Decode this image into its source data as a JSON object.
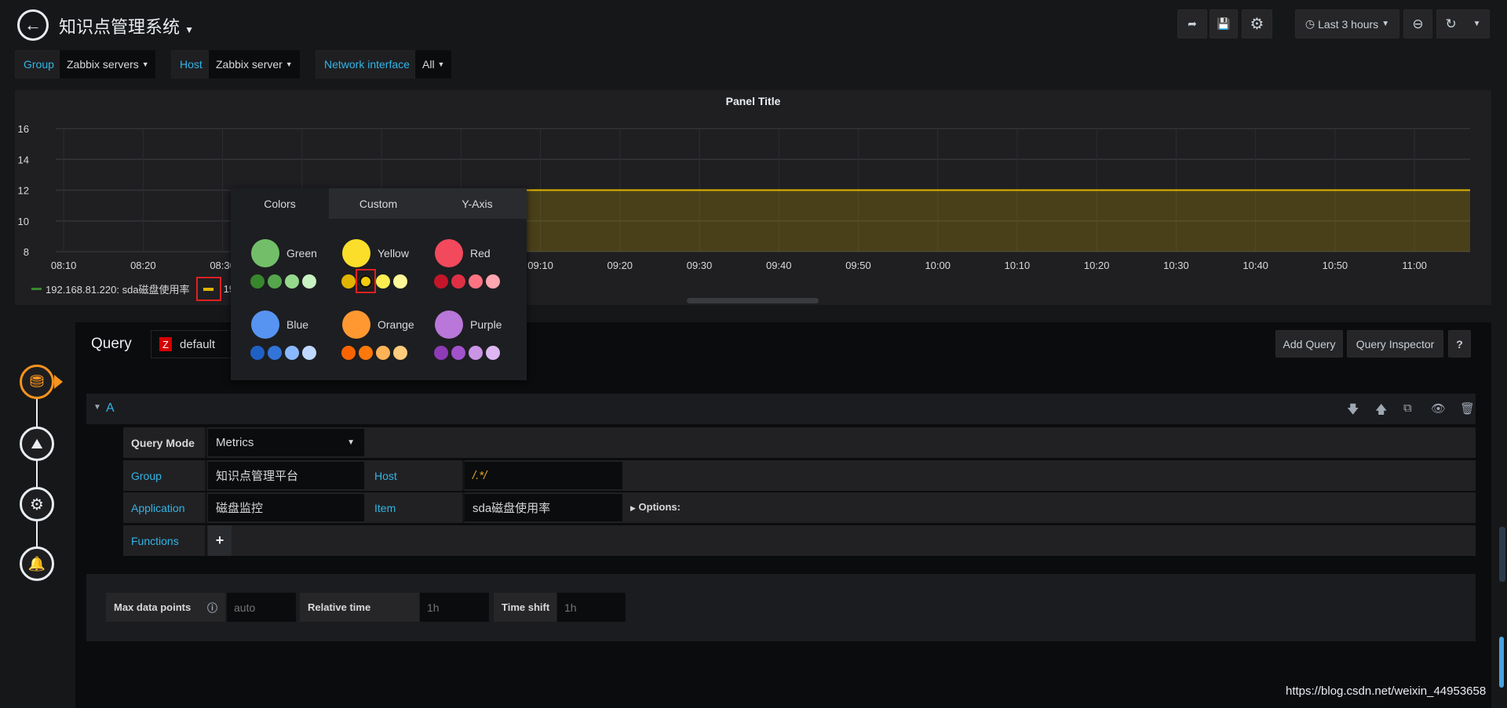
{
  "header": {
    "title": "知识点管理系统",
    "time_range": "Last 3 hours"
  },
  "icons": {
    "back": "arrow-left-icon",
    "share": "share-icon",
    "save": "save-icon",
    "settings": "gear-icon",
    "clock": "clock-icon",
    "zoom_out": "zoom-out-icon",
    "refresh": "refresh-icon"
  },
  "variables": [
    {
      "label": "Group",
      "value": "Zabbix servers"
    },
    {
      "label": "Host",
      "value": "Zabbix server"
    },
    {
      "label": "Network interface",
      "value": "All"
    }
  ],
  "panel": {
    "title": "Panel Title"
  },
  "chart_data": {
    "type": "area",
    "title": "Panel Title",
    "x_ticks": [
      "08:10",
      "08:20",
      "08:30",
      "08:40",
      "08:50",
      "09:00",
      "09:10",
      "09:20",
      "09:30",
      "09:40",
      "09:50",
      "10:00",
      "10:10",
      "10:20",
      "10:30",
      "10:40",
      "10:50",
      "11:00"
    ],
    "x_range": [
      "08:09",
      "11:07"
    ],
    "y_ticks": [
      8,
      10,
      12,
      14,
      16
    ],
    "ylim": [
      8,
      16
    ],
    "grid": true,
    "series": [
      {
        "name": "192.168.81.220: sda磁盘使用率",
        "color": "#37872d",
        "points": []
      },
      {
        "name": "19",
        "color": "#e0b400",
        "points": [
          [
            "09:00",
            12
          ],
          [
            "11:07",
            12
          ]
        ]
      }
    ],
    "legend_position": "bottom-left"
  },
  "color_picker": {
    "tabs": [
      "Colors",
      "Custom",
      "Y-Axis"
    ],
    "active_tab": "Colors",
    "groups": [
      {
        "name": "Green",
        "main": "#73bf69",
        "shades": [
          "#37872d",
          "#56a64b",
          "#96d98d",
          "#c8f2c2"
        ]
      },
      {
        "name": "Yellow",
        "main": "#fade2a",
        "shades": [
          "#e0b400",
          "#f2cc0c",
          "#ffee52",
          "#fff899"
        ]
      },
      {
        "name": "Red",
        "main": "#f2495c",
        "shades": [
          "#c4162a",
          "#e02f44",
          "#ff7383",
          "#ffa6b0"
        ]
      },
      {
        "name": "Blue",
        "main": "#5794f2",
        "shades": [
          "#1f60c4",
          "#3274d9",
          "#8ab8ff",
          "#c0d8ff"
        ]
      },
      {
        "name": "Orange",
        "main": "#ff9830",
        "shades": [
          "#fa6400",
          "#ff780a",
          "#ffb357",
          "#ffcb7d"
        ]
      },
      {
        "name": "Purple",
        "main": "#b877d9",
        "shades": [
          "#8f3bb8",
          "#a352cc",
          "#ca95e5",
          "#deb6f2"
        ]
      }
    ],
    "selected": "#f2cc0c"
  },
  "query": {
    "label": "Query",
    "datasource": "default",
    "datasource_badge": "Z",
    "add_query": "Add Query",
    "inspector": "Query Inspector",
    "help": "?",
    "ref": "A",
    "mode_label": "Query Mode",
    "mode_value": "Metrics",
    "group_label": "Group",
    "group_value": "知识点管理平台",
    "host_label": "Host",
    "host_value": "/.*/",
    "app_label": "Application",
    "app_value": "磁盘监控",
    "item_label": "Item",
    "item_value": "sda磁盘使用率",
    "options_label": "Options:",
    "functions_label": "Functions",
    "add_function": "+"
  },
  "options": {
    "max_points_label": "Max data points",
    "max_points_placeholder": "auto",
    "relative_label": "Relative time",
    "relative_placeholder": "1h",
    "shift_label": "Time shift",
    "shift_placeholder": "1h"
  },
  "watermark": "https://blog.csdn.net/weixin_44953658"
}
